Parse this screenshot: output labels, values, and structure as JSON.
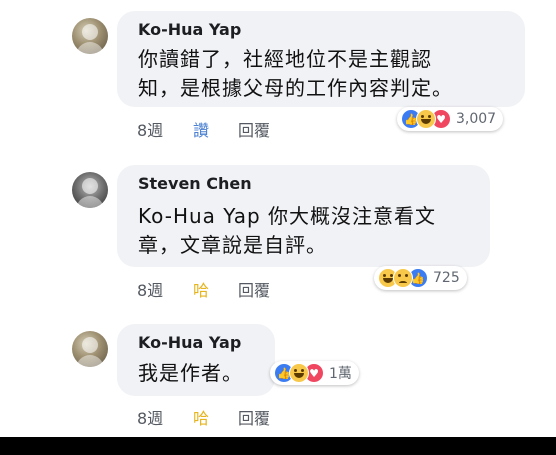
{
  "comments": [
    {
      "author": "Ko-Hua Yap",
      "lines": [
        "你讀錯了，社經地位不是主觀認",
        "知，是根據父母的工作內容判定。"
      ],
      "time": "8週",
      "like_label": "讚",
      "reply_label": "回覆",
      "reactions": {
        "icons": [
          "like-icon",
          "haha-icon",
          "love-icon"
        ],
        "count": "3,007"
      }
    },
    {
      "author": "Steven Chen",
      "lines": [
        "Ko-Hua Yap 你大概沒注意看文",
        "章，文章說是自評。"
      ],
      "time": "8週",
      "like_label": "哈",
      "reply_label": "回覆",
      "reactions": {
        "icons": [
          "haha-icon",
          "sad-icon",
          "like-icon"
        ],
        "count": "725"
      }
    },
    {
      "author": "Ko-Hua Yap",
      "lines": [
        "我是作者。"
      ],
      "time": "8週",
      "like_label": "哈",
      "reply_label": "回覆",
      "reactions": {
        "icons": [
          "like-icon",
          "haha-icon",
          "love-icon"
        ],
        "count": "1萬"
      }
    }
  ],
  "colors": {
    "bubble": "#f1f2f6",
    "like_blue": "#3b7cf2",
    "haha_yellow": "#f7c84a",
    "love_red": "#f0465f",
    "action_blue": "#4a7fd1",
    "action_yellow": "#e5b521"
  }
}
